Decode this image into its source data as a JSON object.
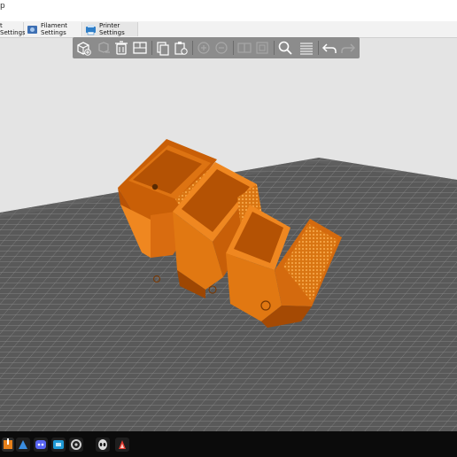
{
  "window": {
    "title_fragment": "p"
  },
  "tabs": [
    {
      "label": "t Settings",
      "icon": "print-settings-icon",
      "active": false
    },
    {
      "label": "Filament Settings",
      "icon": "filament-settings-icon",
      "active": false
    },
    {
      "label": "Printer Settings",
      "icon": "printer-settings-icon",
      "active": true
    }
  ],
  "toolbar": {
    "items": [
      "add-object",
      "delete",
      "delete-all",
      "arrange",
      "copy",
      "paste",
      "add-instance",
      "remove-instance",
      "split-to-objects",
      "split-to-parts",
      "search",
      "layers-editing",
      "undo",
      "redo"
    ]
  },
  "scene": {
    "model_color": "#e6801a",
    "bed_color": "#5a5a5a",
    "grid_color": "#9a9a9a"
  },
  "taskbar": {
    "apps": [
      "windows-start-icon",
      "app-orange-icon",
      "app-blue-icon",
      "app-purple-icon",
      "app-teal-icon",
      "app-gear-icon",
      "app-alien-icon",
      "app-red-icon"
    ]
  }
}
